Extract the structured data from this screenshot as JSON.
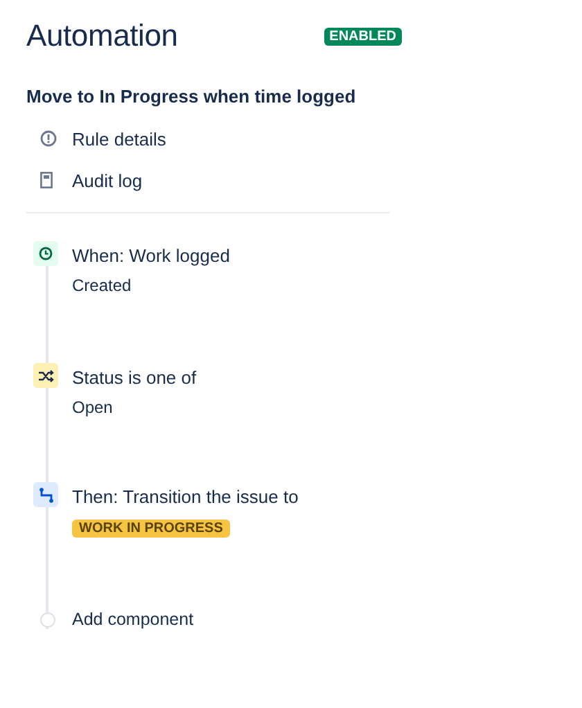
{
  "header": {
    "title": "Automation",
    "status": "ENABLED"
  },
  "rule": {
    "name": "Move to In Progress when time logged"
  },
  "nav": [
    {
      "kind": "info",
      "label": "Rule details"
    },
    {
      "kind": "log",
      "label": "Audit log"
    }
  ],
  "steps": [
    {
      "kind": "trigger",
      "title": "When: Work logged",
      "detail": {
        "kind": "text",
        "text": "Created"
      }
    },
    {
      "kind": "condition",
      "title": "Status is one of",
      "detail": {
        "kind": "text",
        "text": "Open"
      }
    },
    {
      "kind": "action",
      "title": "Then: Transition the issue to",
      "detail": {
        "kind": "lozenge",
        "text": "WORK IN PROGRESS"
      }
    }
  ],
  "add_component": {
    "label": "Add component"
  }
}
